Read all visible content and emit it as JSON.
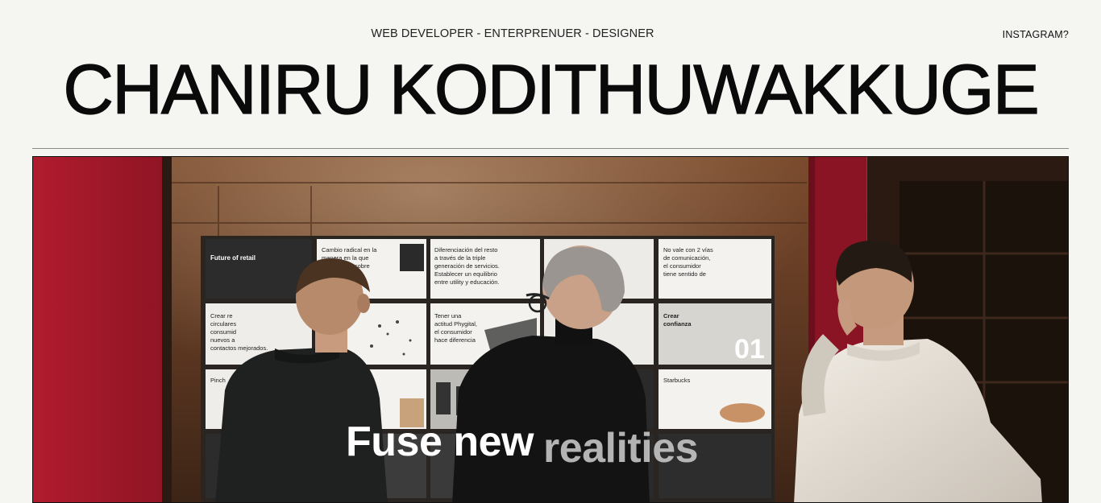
{
  "header": {
    "tagline": "WEB DEVELOPER - ENTERPRENUER - DESIGNER",
    "instagram_link": "INSTAGRAM?",
    "name": "CHANIRU KODITHUWAKKUGE"
  },
  "hero": {
    "caption_word_1": "Fuse new",
    "caption_word_2": "realities",
    "board_texts": {
      "card_1": "Future of retail",
      "card_2": "Cambio radical en la manera en la que consumidor sobre consumidor.",
      "card_3": "Diferenciación del resto a través de la triple generación de servicios. Establecer un equilibrio entre utility y educación.",
      "card_4": "No vale con 2 vías de comunicación, el consumidor tiene sentido de pertenencia.",
      "card_5": "Crear re circulares consumid nuevos a contactos mejorados.",
      "card_6": "Tener una actitud Phygital, el consumidor hace diferencia entre los 2 mundos.",
      "card_7": "Crear confianza",
      "card_8": "Pinch",
      "card_9": "Starbucks"
    },
    "colors": {
      "red_wall": "#a3182a",
      "wood": "#6b4128",
      "page_bg": "#f5f5f2"
    }
  }
}
